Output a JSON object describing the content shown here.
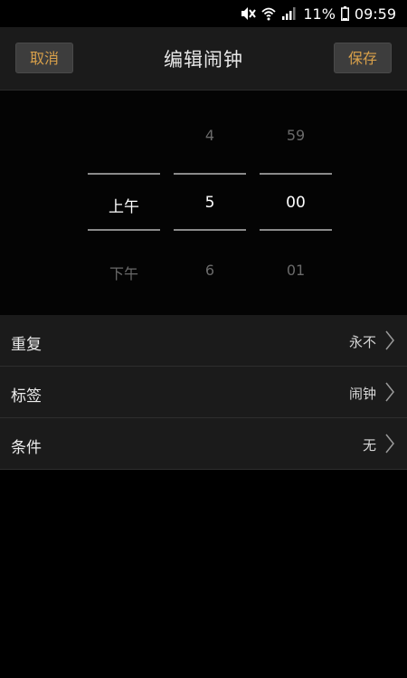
{
  "status_bar": {
    "battery_percent": "11%",
    "time": "09:59",
    "icons": [
      "mute-icon",
      "wifi-icon",
      "signal-icon",
      "battery-icon"
    ]
  },
  "header": {
    "cancel_label": "取消",
    "title": "编辑闹钟",
    "save_label": "保存"
  },
  "picker": {
    "ampm": {
      "prev": "",
      "current": "上午",
      "next": "下午"
    },
    "hour": {
      "prev": "4",
      "current": "5",
      "next": "6"
    },
    "minute": {
      "prev": "59",
      "current": "00",
      "next": "01"
    }
  },
  "settings": [
    {
      "label": "重复",
      "value": "永不"
    },
    {
      "label": "标签",
      "value": "闹钟"
    },
    {
      "label": "条件",
      "value": "无"
    }
  ],
  "colors": {
    "accent": "#d8a04a",
    "background": "#000000",
    "panel": "#1b1b1b"
  }
}
